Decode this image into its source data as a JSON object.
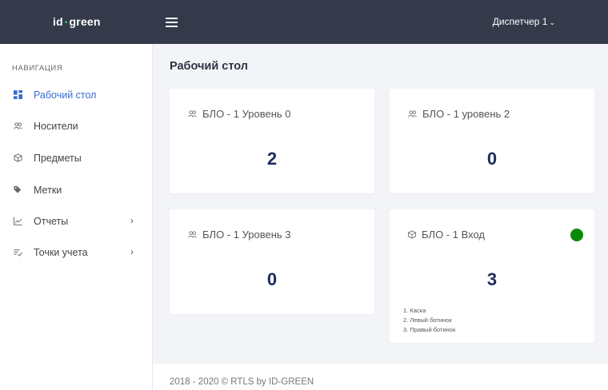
{
  "header": {
    "logo_left": "id",
    "logo_dot": "•",
    "logo_right": "green",
    "user_label": "Диспетчер 1",
    "user_chevron": "⌄",
    "accent_dot_color": "#2fbf4a"
  },
  "sidebar": {
    "heading": "НАВИГАЦИЯ",
    "items": [
      {
        "label": "Рабочий стол",
        "icon": "dashboard-icon",
        "active": true
      },
      {
        "label": "Носители",
        "icon": "users-icon"
      },
      {
        "label": "Предметы",
        "icon": "cube-icon"
      },
      {
        "label": "Метки",
        "icon": "tags-icon"
      },
      {
        "label": "Отчеты",
        "icon": "chart-icon",
        "arrow": "›"
      },
      {
        "label": "Точки учета",
        "icon": "list-check-icon",
        "arrow": "›"
      }
    ],
    "active_color": "#3b6bcc"
  },
  "main": {
    "title": "Рабочий стол",
    "cards": [
      {
        "title": "БЛО - 1 Уровень 0",
        "icon": "users-icon",
        "value": "2"
      },
      {
        "title": "БЛО - 1 уровень 2",
        "icon": "users-icon",
        "value": "0"
      },
      {
        "title": "БЛО - 1 Уровень 3",
        "icon": "users-icon",
        "value": "0"
      },
      {
        "title": "БЛО - 1 Вход",
        "icon": "cube-icon",
        "value": "3",
        "status_color": "#0a8a0a",
        "items": [
          "1. Каска",
          "2. Левый ботинок",
          "3. Правый ботинок"
        ]
      }
    ],
    "value_color": "#1e2b5e"
  },
  "footer": {
    "text": "2018 - 2020 © RTLS by ID-GREEN"
  }
}
